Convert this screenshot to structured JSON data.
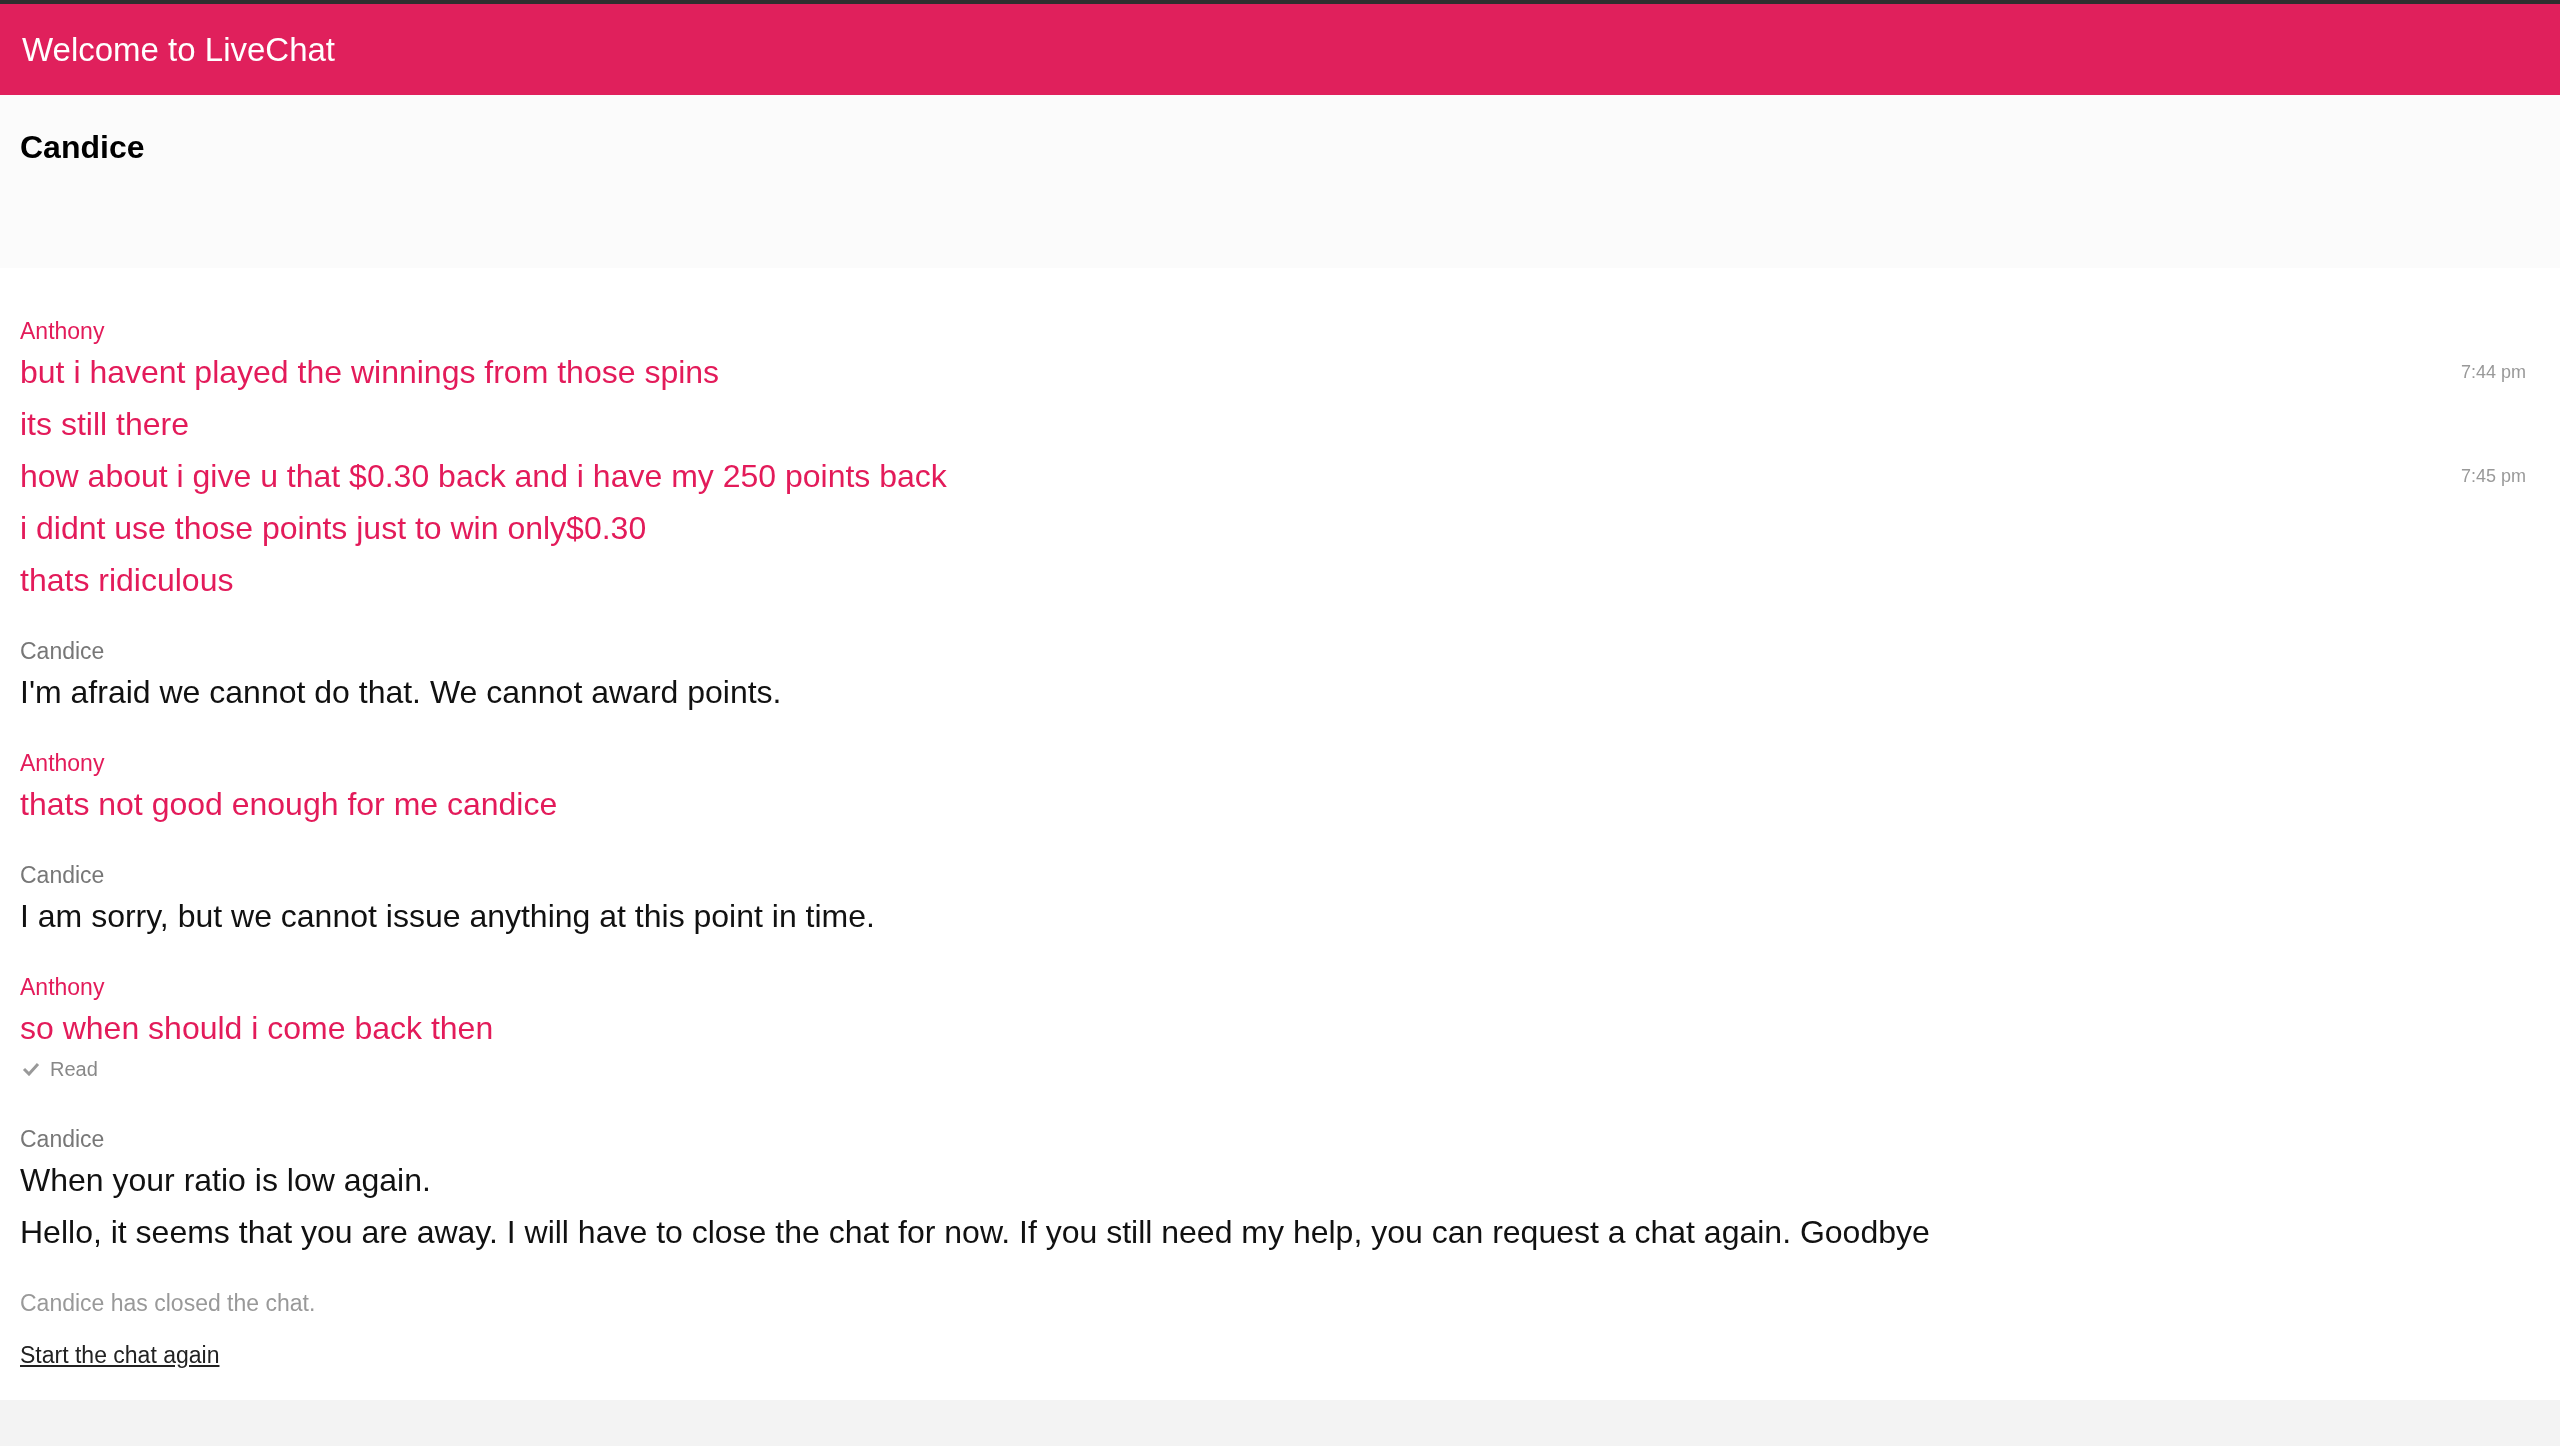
{
  "header": {
    "title": "Welcome to LiveChat"
  },
  "agent_bar": {
    "name": "Candice"
  },
  "groups": [
    {
      "kind": "visitor",
      "author": "Anthony",
      "lines": [
        {
          "text": "but i havent played the winnings from those spins",
          "time": "7:44 pm"
        },
        {
          "text": "its still there"
        },
        {
          "text": "how about i give u that $0.30 back and i have my 250 points back",
          "time": "7:45 pm"
        },
        {
          "text": "i didnt use those points just to win only$0.30"
        },
        {
          "text": "thats ridiculous"
        }
      ]
    },
    {
      "kind": "agent",
      "author": "Candice",
      "lines": [
        {
          "text": "I'm afraid we cannot do that. We cannot award points."
        }
      ]
    },
    {
      "kind": "visitor",
      "author": "Anthony",
      "lines": [
        {
          "text": "thats not good enough for me candice"
        }
      ]
    },
    {
      "kind": "agent",
      "author": "Candice",
      "lines": [
        {
          "text": "I am sorry, but we cannot issue anything at this point in time."
        }
      ]
    },
    {
      "kind": "visitor",
      "author": "Anthony",
      "lines": [
        {
          "text": "so when should i come back then"
        }
      ],
      "receipt": "Read"
    },
    {
      "kind": "agent",
      "author": "Candice",
      "lines": [
        {
          "text": "When your ratio is low again."
        },
        {
          "text": "Hello, it seems that you are away. I will have to close the chat for now. If you still need my help, you can request a chat again. Goodbye"
        }
      ]
    }
  ],
  "system_note": "Candice has closed the chat.",
  "restart_link": "Start the chat again"
}
